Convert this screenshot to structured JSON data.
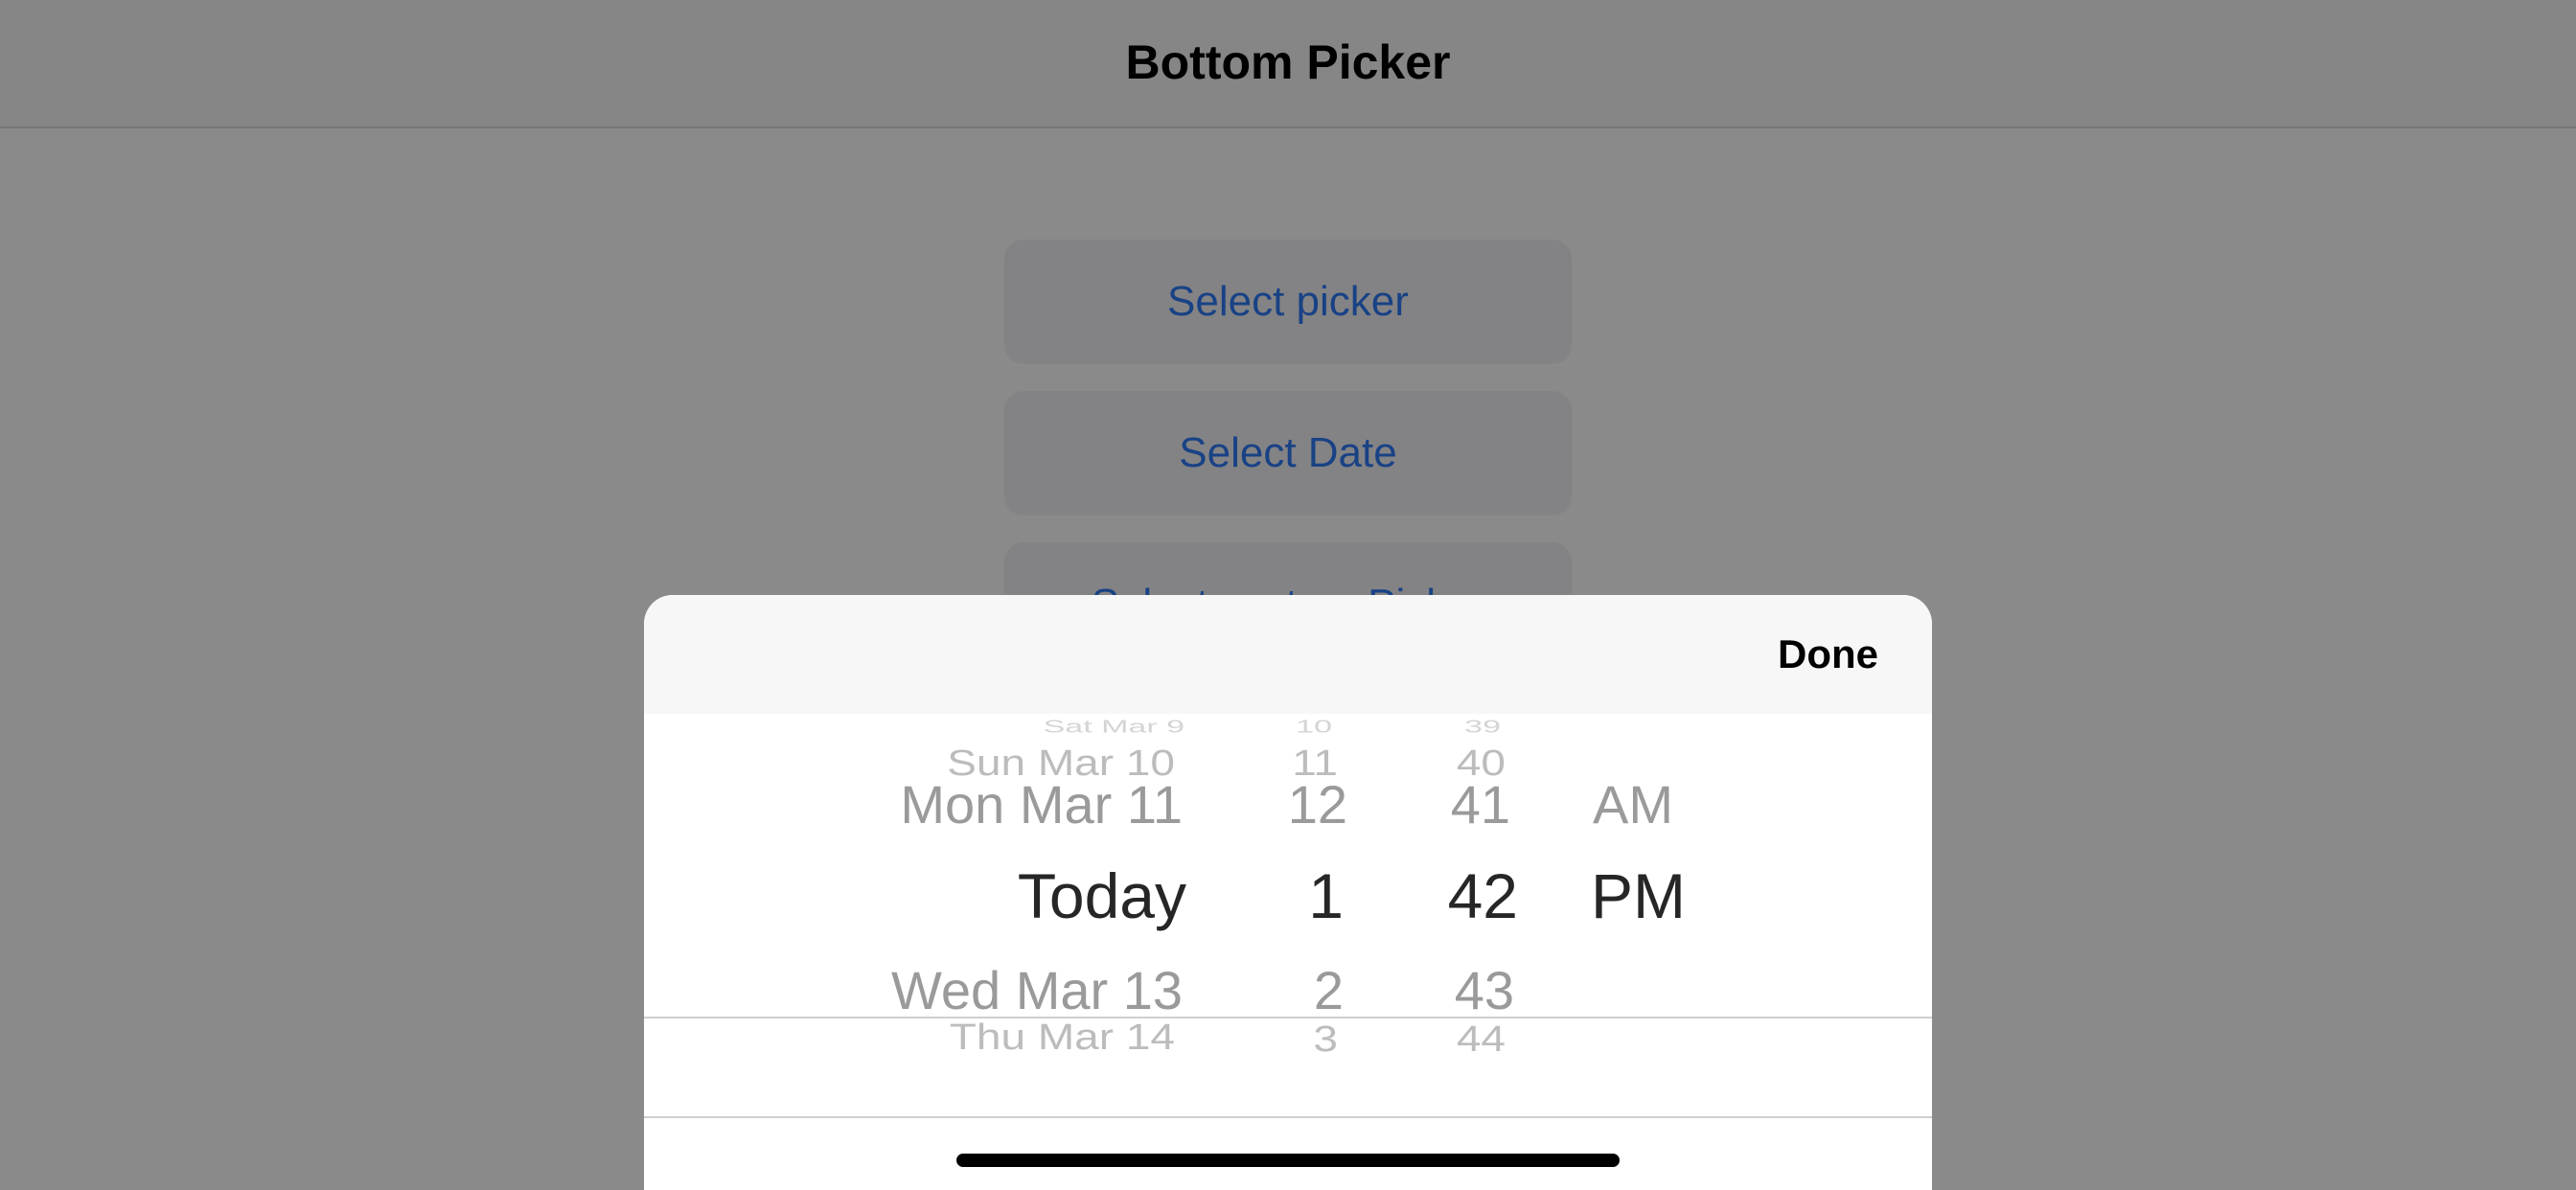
{
  "navbar": {
    "title": "Bottom Picker"
  },
  "buttons": {
    "select_picker": "Select picker",
    "select_date": "Select Date",
    "select_custom_picker": "Select custom Picker"
  },
  "picker": {
    "done_label": "Done",
    "columns": {
      "date": [
        "Sat Mar 9",
        "Sun Mar 10",
        "Mon Mar 11",
        "Today",
        "Wed Mar 13",
        "Thu Mar 14"
      ],
      "hour": [
        "10",
        "11",
        "12",
        "1",
        "2",
        "3"
      ],
      "minute": [
        "39",
        "40",
        "41",
        "42",
        "43",
        "44"
      ],
      "ampm": [
        "AM",
        "PM"
      ]
    },
    "selected": {
      "date": "Today",
      "hour": "1",
      "minute": "42",
      "ampm": "PM"
    }
  },
  "colors": {
    "accent": "#2f7bf6",
    "dim_overlay": "#000000",
    "selected_text": "#262626",
    "unselected_text": "#9a9a9a"
  }
}
